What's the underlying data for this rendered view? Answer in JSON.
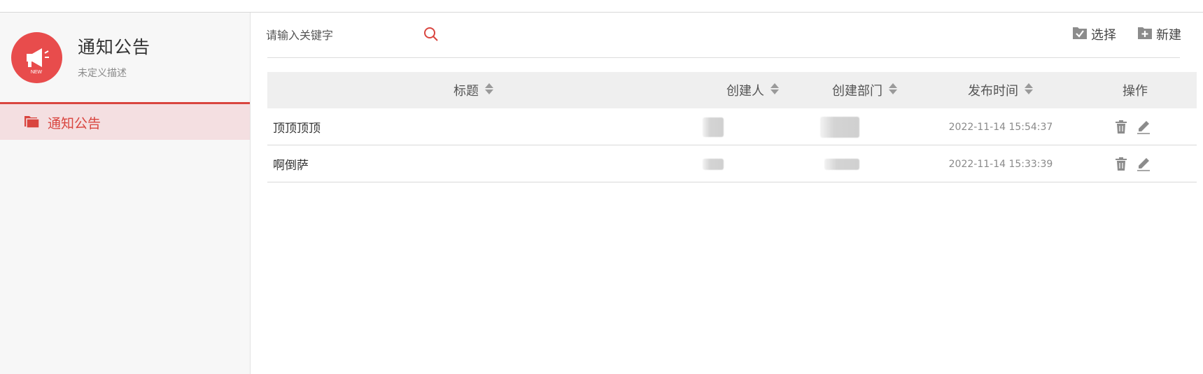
{
  "app": {
    "title": "通知公告",
    "description": "未定义描述",
    "logo_badge": "NEW",
    "accent_color": "#d9453f"
  },
  "sidebar": {
    "items": [
      {
        "label": "通知公告",
        "icon": "folder-icon",
        "active": true
      }
    ]
  },
  "search": {
    "placeholder": "请输入关键字",
    "value": "",
    "icon": "search-icon"
  },
  "toolbar": {
    "select_label": "选择",
    "new_label": "新建"
  },
  "table": {
    "columns": [
      "标题",
      "创建人",
      "创建部门",
      "发布时间",
      "操作"
    ],
    "sortable": [
      true,
      true,
      true,
      true,
      false
    ],
    "rows": [
      {
        "title": "顶顶顶顶",
        "creator": "",
        "department": "",
        "published": "2022-11-14 15:54:37"
      },
      {
        "title": "啊倒萨",
        "creator": "",
        "department": "",
        "published": "2022-11-14 15:33:39"
      }
    ],
    "row_actions": [
      "trash-icon",
      "edit-pencil-icon"
    ]
  }
}
